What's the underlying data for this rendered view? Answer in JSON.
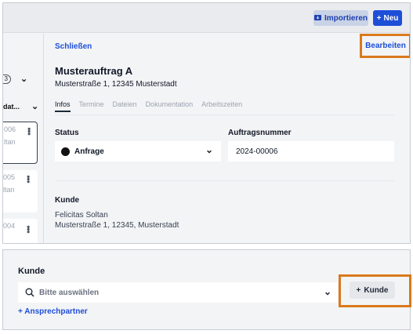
{
  "toolbar": {
    "import_label": "Importieren",
    "new_label": "Neu"
  },
  "list": {
    "pill_text": "3",
    "column_label": "dat...",
    "items": [
      {
        "number": "006",
        "name": "ltan"
      },
      {
        "number": "005",
        "name": "ltan"
      },
      {
        "number": "004",
        "name": ""
      }
    ]
  },
  "detail": {
    "close_label": "Schließen",
    "edit_label": "Bearbeiten",
    "title": "Musterauftrag A",
    "address": "Musterstraße 1, 12345 Musterstadt",
    "tabs": [
      {
        "label": "Infos",
        "active": true
      },
      {
        "label": "Termine",
        "active": false
      },
      {
        "label": "Dateien",
        "active": false
      },
      {
        "label": "Dokumentation",
        "active": false
      },
      {
        "label": "Arbeitszeiten",
        "active": false
      }
    ],
    "status_label": "Status",
    "status_value": "Anfrage",
    "order_number_label": "Auftragsnummer",
    "order_number_value": "2024-00006",
    "customer_label": "Kunde",
    "customer_name": "Felicitas Soltan",
    "customer_address": "Musterstraße 1, 12345, Musterstadt"
  },
  "customer_section": {
    "title": "Kunde",
    "search_placeholder": "Bitte auswählen",
    "add_customer_label": "Kunde",
    "add_contact_label": "+ Ansprechpartner"
  },
  "colors": {
    "accent": "#1d4ed8",
    "highlight": "#d97a1c"
  }
}
